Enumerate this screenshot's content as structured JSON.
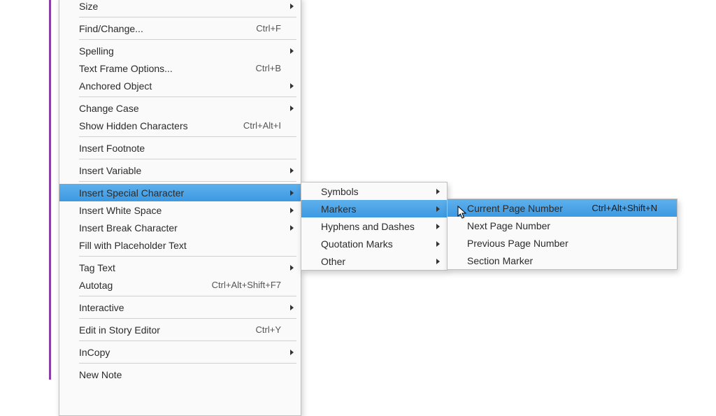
{
  "main_menu": {
    "items": [
      {
        "label": "Size",
        "submenu": true
      },
      "sep",
      {
        "label": "Find/Change...",
        "shortcut": "Ctrl+F"
      },
      "sep",
      {
        "label": "Spelling",
        "submenu": true
      },
      {
        "label": "Text Frame Options...",
        "shortcut": "Ctrl+B"
      },
      {
        "label": "Anchored Object",
        "submenu": true
      },
      "sep",
      {
        "label": "Change Case",
        "submenu": true
      },
      {
        "label": "Show Hidden Characters",
        "shortcut": "Ctrl+Alt+I"
      },
      "sep",
      {
        "label": "Insert Footnote"
      },
      "sep",
      {
        "label": "Insert Variable",
        "submenu": true
      },
      "sep",
      {
        "label": "Insert Special Character",
        "submenu": true,
        "highlighted": true
      },
      {
        "label": "Insert White Space",
        "submenu": true
      },
      {
        "label": "Insert Break Character",
        "submenu": true
      },
      {
        "label": "Fill with Placeholder Text"
      },
      "sep",
      {
        "label": "Tag Text",
        "submenu": true
      },
      {
        "label": "Autotag",
        "shortcut": "Ctrl+Alt+Shift+F7"
      },
      "sep",
      {
        "label": "Interactive",
        "submenu": true
      },
      "sep",
      {
        "label": "Edit in Story Editor",
        "shortcut": "Ctrl+Y"
      },
      "sep",
      {
        "label": "InCopy",
        "submenu": true
      },
      "sep",
      {
        "label": "New Note"
      }
    ]
  },
  "sub_menu_1": {
    "items": [
      {
        "label": "Symbols",
        "submenu": true
      },
      {
        "label": "Markers",
        "submenu": true,
        "highlighted": true
      },
      {
        "label": "Hyphens and Dashes",
        "submenu": true
      },
      {
        "label": "Quotation Marks",
        "submenu": true
      },
      {
        "label": "Other",
        "submenu": true
      }
    ]
  },
  "sub_menu_2": {
    "items": [
      {
        "label": "Current Page Number",
        "shortcut": "Ctrl+Alt+Shift+N",
        "highlighted": true
      },
      {
        "label": "Next Page Number"
      },
      {
        "label": "Previous Page Number"
      },
      {
        "label": "Section Marker"
      }
    ]
  }
}
